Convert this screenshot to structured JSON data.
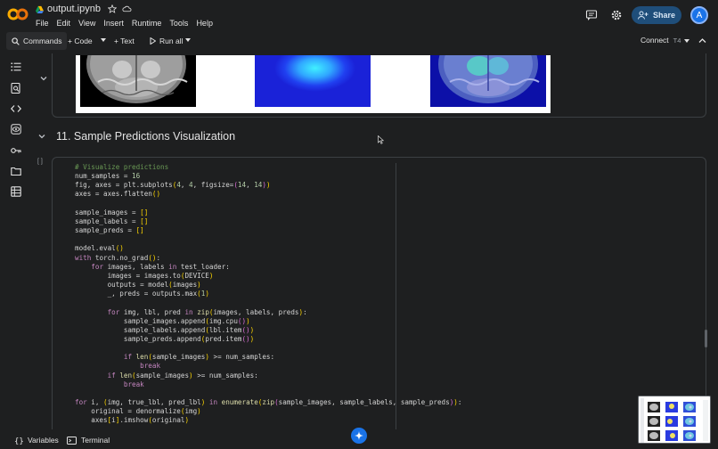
{
  "header": {
    "filename": "output.ipynb",
    "menu": [
      "File",
      "Edit",
      "View",
      "Insert",
      "Runtime",
      "Tools",
      "Help"
    ],
    "share_label": "Share",
    "avatar_letter": "A"
  },
  "toolbar": {
    "commands_label": "Commands",
    "code_label": "+ Code",
    "text_label": "+ Text",
    "run_all_label": "Run all",
    "connect_label": "Connect",
    "runtime_type": "T4"
  },
  "section": {
    "title": "11. Sample Predictions Visualization"
  },
  "cell": {
    "status": "[ ]",
    "output_dots": "..."
  },
  "bottom": {
    "variables_label": "Variables",
    "terminal_label": "Terminal"
  },
  "colors": {
    "share_bg": "#1f4e7a",
    "avatar": "#1a73e8",
    "fab": "#1a73e8",
    "logo_orange": "#f9ab00",
    "logo_dark_orange": "#e8710a"
  }
}
